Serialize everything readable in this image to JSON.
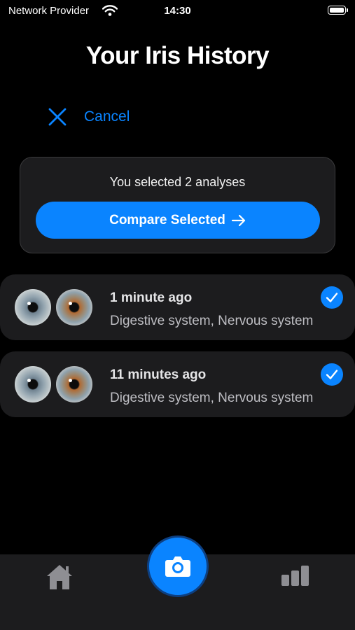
{
  "status_bar": {
    "carrier": "Network Provider",
    "time": "14:30"
  },
  "header": {
    "title": "Your Iris History"
  },
  "selection": {
    "cancel_label": "Cancel",
    "count_text": "You selected 2 analyses",
    "compare_label": "Compare Selected"
  },
  "history": [
    {
      "time": "1 minute ago",
      "systems": "Digestive system, Nervous system",
      "selected": true
    },
    {
      "time": "11 minutes ago",
      "systems": "Digestive system, Nervous system",
      "selected": true
    }
  ],
  "tab_bar": {
    "items": [
      "home-icon",
      "camera-icon",
      "bar-chart-icon"
    ]
  },
  "colors": {
    "accent": "#0a84ff",
    "background": "#000000",
    "card": "#1c1c1e"
  }
}
